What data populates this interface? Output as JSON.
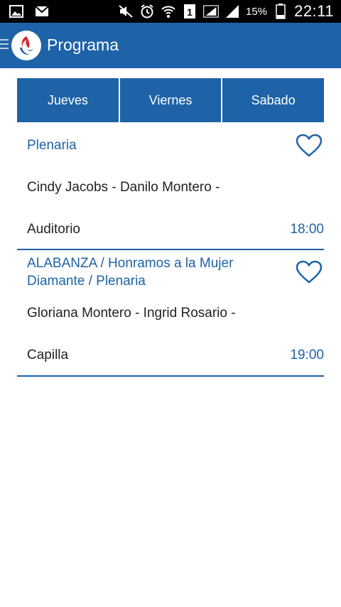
{
  "status_bar": {
    "battery_percent": "15%",
    "clock": "22:11",
    "icons": [
      "image-icon",
      "mail-icon",
      "mute-icon",
      "alarm-icon",
      "wifi-icon",
      "sim1-icon",
      "signal-icon",
      "signal2-icon",
      "battery-icon"
    ]
  },
  "app_bar": {
    "title": "Programa",
    "brand_color": "#1e63a7"
  },
  "tabs": [
    {
      "label": "Jueves"
    },
    {
      "label": "Viernes"
    },
    {
      "label": "Sabado"
    }
  ],
  "sessions": [
    {
      "title": "Plenaria",
      "speakers": "Cindy Jacobs - Danilo Montero -",
      "room": "Auditorio",
      "time": "18:00"
    },
    {
      "title": "ALABANZA / Honramos a la Mujer Diamante / Plenaria",
      "speakers": "Gloriana Montero - Ingrid Rosario -",
      "room": "Capilla",
      "time": "19:00"
    }
  ]
}
